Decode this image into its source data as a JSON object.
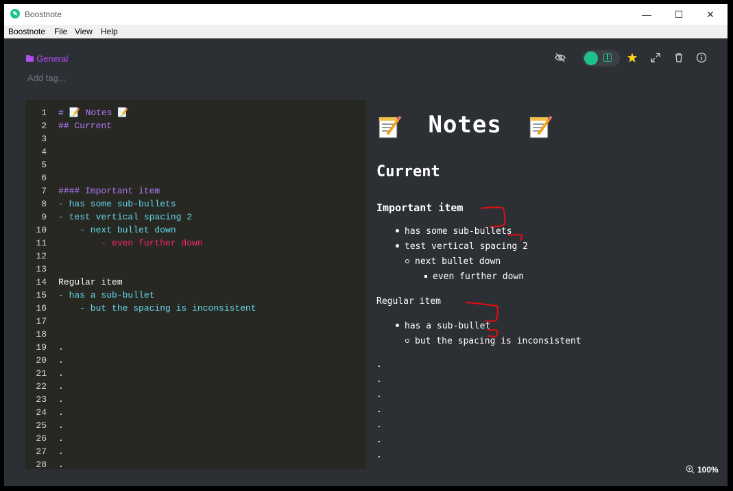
{
  "window": {
    "title": "Boostnote"
  },
  "menu": [
    "Boostnote",
    "File",
    "View",
    "Help"
  ],
  "folder": {
    "label": "General"
  },
  "tags": {
    "placeholder": "Add tag..."
  },
  "editor": {
    "lines": [
      {
        "num": "1",
        "text": "# 📝 Notes 📝",
        "style": "c-head"
      },
      {
        "num": "2",
        "text": "## Current",
        "style": "c-head"
      },
      {
        "num": "3",
        "text": "",
        "style": "c-text"
      },
      {
        "num": "4",
        "text": "",
        "style": "c-text"
      },
      {
        "num": "5",
        "text": "",
        "style": "c-text"
      },
      {
        "num": "6",
        "text": "",
        "style": "c-text"
      },
      {
        "num": "7",
        "text": "#### Important item",
        "style": "c-head"
      },
      {
        "num": "8",
        "text": "- has some sub-bullets",
        "style": "c-list"
      },
      {
        "num": "9",
        "text": "- test vertical spacing 2",
        "style": "c-list"
      },
      {
        "num": "10",
        "text": "    - next bullet down",
        "style": "c-list"
      },
      {
        "num": "11",
        "text": "        - even further down",
        "style": "c-list2"
      },
      {
        "num": "12",
        "text": "",
        "style": "c-text"
      },
      {
        "num": "13",
        "text": "",
        "style": "c-text"
      },
      {
        "num": "14",
        "text": "Regular item",
        "style": "c-text"
      },
      {
        "num": "15",
        "text": "- has a sub-bullet",
        "style": "c-list"
      },
      {
        "num": "16",
        "text": "    - but the spacing is inconsistent",
        "style": "c-list"
      },
      {
        "num": "17",
        "text": "",
        "style": "c-text"
      },
      {
        "num": "18",
        "text": "",
        "style": "c-text"
      },
      {
        "num": "19",
        "text": ".",
        "style": "c-text"
      },
      {
        "num": "20",
        "text": ".",
        "style": "c-text"
      },
      {
        "num": "21",
        "text": ".",
        "style": "c-text"
      },
      {
        "num": "22",
        "text": ".",
        "style": "c-text"
      },
      {
        "num": "23",
        "text": ".",
        "style": "c-text"
      },
      {
        "num": "24",
        "text": ".",
        "style": "c-text"
      },
      {
        "num": "25",
        "text": ".",
        "style": "c-text"
      },
      {
        "num": "26",
        "text": ".",
        "style": "c-text"
      },
      {
        "num": "27",
        "text": ".",
        "style": "c-text"
      },
      {
        "num": "28",
        "text": ".",
        "style": "c-text"
      }
    ]
  },
  "preview": {
    "h1": "Notes",
    "h2": "Current",
    "h4": "Important item",
    "important_bullets": [
      "has some sub-bullets",
      "test vertical spacing 2"
    ],
    "nested_1": "next bullet down",
    "nested_2": "even further down",
    "regular": "Regular item",
    "regular_bullet": "has a sub-bullet",
    "regular_nested": "but the spacing is inconsistent",
    "dots": [
      ".",
      ".",
      ".",
      ".",
      ".",
      ".",
      "."
    ]
  },
  "zoom": {
    "label": "100%"
  },
  "colors": {
    "accent": "#1ec38b",
    "folder": "#b44bf0",
    "star": "#f8d320",
    "annotation": "#e01010"
  },
  "toolbar_icons": [
    "eye-off-icon",
    "mode-toggle",
    "star-icon",
    "expand-icon",
    "trash-icon",
    "info-icon"
  ]
}
